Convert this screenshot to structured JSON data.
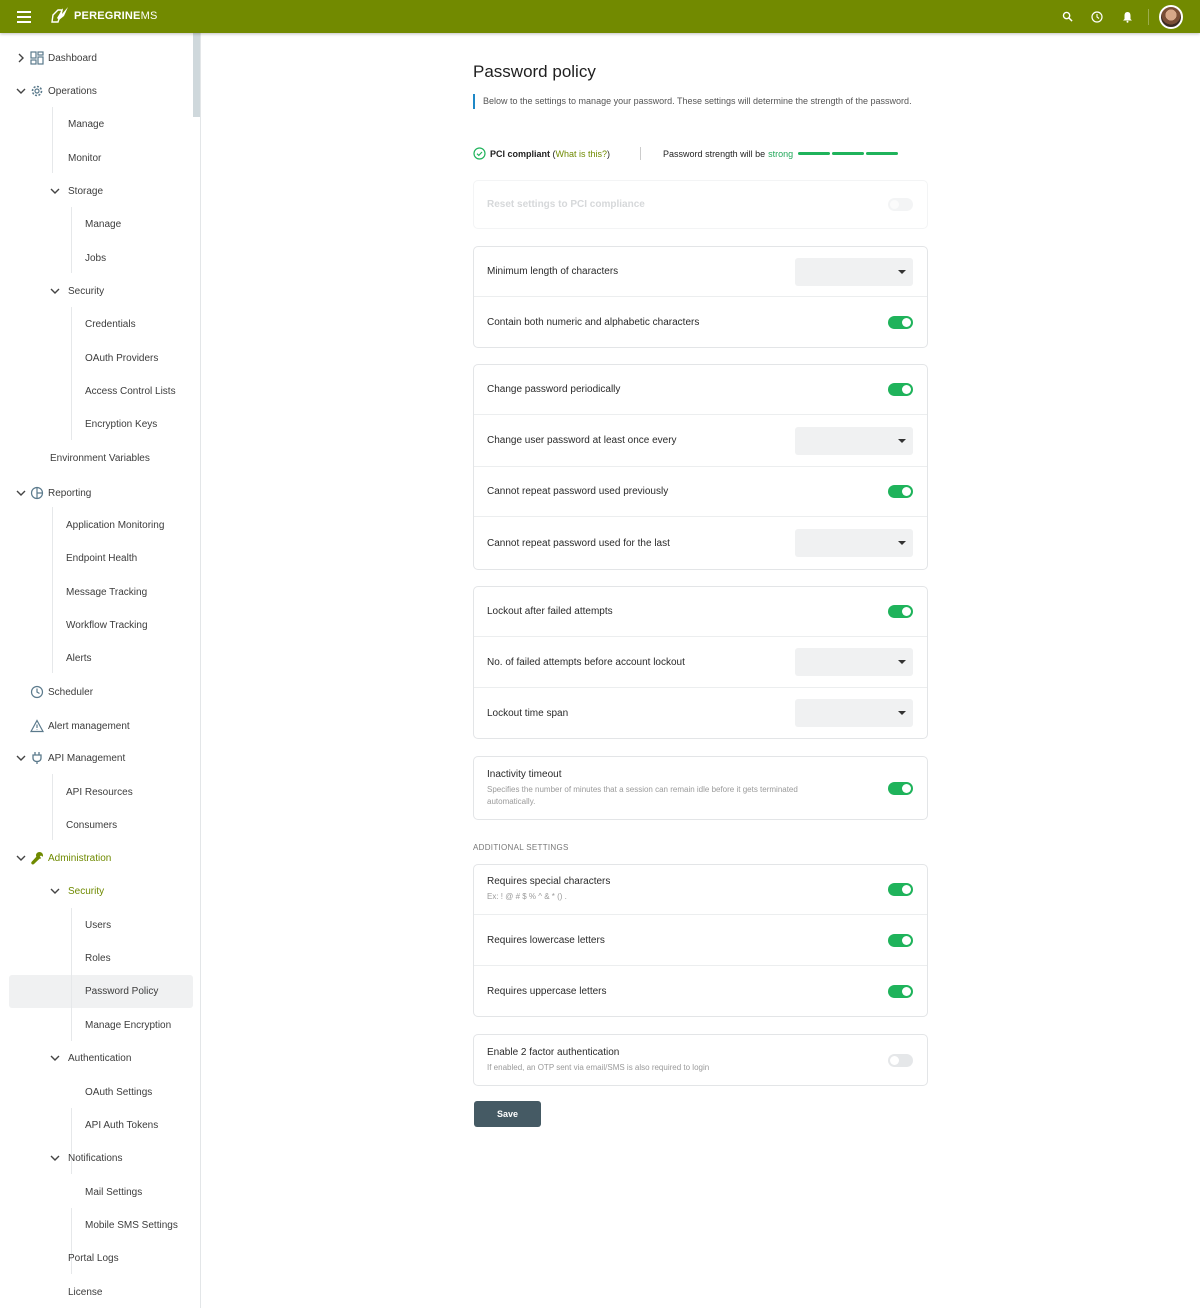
{
  "app": {
    "brand_bold": "PEREGRINE",
    "brand_light": "MS",
    "brand_color": "#728a00",
    "accent_green": "#1fb35b",
    "top_icons": [
      "search-icon",
      "history-icon",
      "bell-icon",
      "avatar"
    ]
  },
  "sidebar": {
    "items": [
      {
        "label": "Dashboard"
      },
      {
        "label": "Operations"
      },
      {
        "label": "Manage"
      },
      {
        "label": "Monitor"
      },
      {
        "label": "Storage"
      },
      {
        "label": "Manage"
      },
      {
        "label": "Jobs"
      },
      {
        "label": "Security"
      },
      {
        "label": "Credentials"
      },
      {
        "label": "OAuth Providers"
      },
      {
        "label": "Access Control Lists"
      },
      {
        "label": "Encryption Keys"
      },
      {
        "label": "Environment Variables"
      },
      {
        "label": "Reporting"
      },
      {
        "label": "Application Monitoring"
      },
      {
        "label": "Endpoint Health"
      },
      {
        "label": "Message Tracking"
      },
      {
        "label": "Workflow Tracking"
      },
      {
        "label": "Alerts"
      },
      {
        "label": "Scheduler"
      },
      {
        "label": "Alert management"
      },
      {
        "label": "API Management"
      },
      {
        "label": "API Resources"
      },
      {
        "label": "Consumers"
      },
      {
        "label": "Administration"
      },
      {
        "label": "Security"
      },
      {
        "label": "Users"
      },
      {
        "label": "Roles"
      },
      {
        "label": "Password Policy"
      },
      {
        "label": "Manage Encryption"
      },
      {
        "label": "Authentication"
      },
      {
        "label": "OAuth Settings"
      },
      {
        "label": "API Auth Tokens"
      },
      {
        "label": "Notifications"
      },
      {
        "label": "Mail Settings"
      },
      {
        "label": "Mobile SMS Settings"
      },
      {
        "label": "Portal Logs"
      },
      {
        "label": "License"
      }
    ],
    "active": "Password Policy"
  },
  "page": {
    "title": "Password policy",
    "description": "Below to the settings to manage your password. These settings will determine the strength of the password.",
    "pci_label": "PCI compliant",
    "pci_open": " (",
    "pci_link": "What is this?",
    "pci_close": ")",
    "strength_prefix": "Password strength will be",
    "strength_value": "strong",
    "strength_level": "3/3",
    "reset_label": "Reset settings to PCI compliance",
    "reset_enabled": false
  },
  "groups": [
    {
      "rows": [
        {
          "label": "Minimum length of characters",
          "control": "select",
          "value": ""
        },
        {
          "label": "Contain both numeric and alphabetic characters",
          "control": "toggle",
          "value": true
        }
      ]
    },
    {
      "rows": [
        {
          "label": "Change password periodically",
          "control": "toggle",
          "value": true
        },
        {
          "label": "Change user password at least once every",
          "control": "select",
          "value": ""
        },
        {
          "label": "Cannot repeat password used previously",
          "control": "toggle",
          "value": true
        },
        {
          "label": "Cannot repeat password used for the last",
          "control": "select",
          "value": ""
        }
      ]
    },
    {
      "rows": [
        {
          "label": "Lockout after failed attempts",
          "control": "toggle",
          "value": true
        },
        {
          "label": "No. of failed attempts before account lockout",
          "control": "select",
          "value": ""
        },
        {
          "label": "Lockout time span",
          "control": "select",
          "value": ""
        }
      ]
    },
    {
      "rows": [
        {
          "label": "Inactivity timeout",
          "sub": "Specifies the number of minutes that a session can remain idle before it gets terminated automatically.",
          "control": "toggle",
          "value": true
        }
      ]
    }
  ],
  "additional": {
    "heading": "ADDITIONAL SETTINGS",
    "rows": [
      {
        "label": "Requires special characters",
        "sub": "Ex: ! @ # $ % ^ & * () .",
        "control": "toggle",
        "value": true
      },
      {
        "label": "Requires lowercase letters",
        "control": "toggle",
        "value": true
      },
      {
        "label": "Requires uppercase letters",
        "control": "toggle",
        "value": true
      }
    ]
  },
  "two_factor": {
    "label": "Enable 2 factor authentication",
    "sub": "If enabled, an OTP sent via email/SMS is also required to login",
    "value": false
  },
  "save_label": "Save"
}
